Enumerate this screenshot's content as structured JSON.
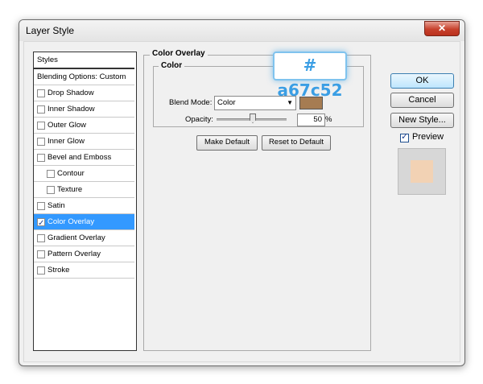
{
  "window": {
    "title": "Layer Style",
    "close_glyph": "✕"
  },
  "styles_list": {
    "header": "Styles",
    "items": [
      {
        "label": "Blending Options: Custom",
        "checkbox": false,
        "checked": false,
        "indent": false
      },
      {
        "label": "Drop Shadow",
        "checkbox": true,
        "checked": false,
        "indent": false
      },
      {
        "label": "Inner Shadow",
        "checkbox": true,
        "checked": false,
        "indent": false
      },
      {
        "label": "Outer Glow",
        "checkbox": true,
        "checked": false,
        "indent": false
      },
      {
        "label": "Inner Glow",
        "checkbox": true,
        "checked": false,
        "indent": false
      },
      {
        "label": "Bevel and Emboss",
        "checkbox": true,
        "checked": false,
        "indent": false
      },
      {
        "label": "Contour",
        "checkbox": true,
        "checked": false,
        "indent": true
      },
      {
        "label": "Texture",
        "checkbox": true,
        "checked": false,
        "indent": true
      },
      {
        "label": "Satin",
        "checkbox": true,
        "checked": false,
        "indent": false
      },
      {
        "label": "Color Overlay",
        "checkbox": true,
        "checked": true,
        "indent": false,
        "selected": true
      },
      {
        "label": "Gradient Overlay",
        "checkbox": true,
        "checked": false,
        "indent": false
      },
      {
        "label": "Pattern Overlay",
        "checkbox": true,
        "checked": false,
        "indent": false
      },
      {
        "label": "Stroke",
        "checkbox": true,
        "checked": false,
        "indent": false
      }
    ]
  },
  "panel": {
    "group_title": "Color Overlay",
    "sub_group_title": "Color",
    "blend_mode_label": "Blend Mode:",
    "blend_mode_value": "Color",
    "overlay_color": "#a67c52",
    "opacity_label": "Opacity:",
    "opacity_value": "50",
    "opacity_unit": "%",
    "opacity_fraction": 0.5,
    "make_default_label": "Make Default",
    "reset_default_label": "Reset to Default"
  },
  "buttons": {
    "ok": "OK",
    "cancel": "Cancel",
    "new_style": "New Style..."
  },
  "preview": {
    "label": "Preview",
    "checked": true,
    "swatch_color": "#f2d2b4"
  },
  "hex_callout": "# a67c52",
  "colors": {
    "selection": "#3399ff",
    "accent": "#3a9ee4"
  }
}
